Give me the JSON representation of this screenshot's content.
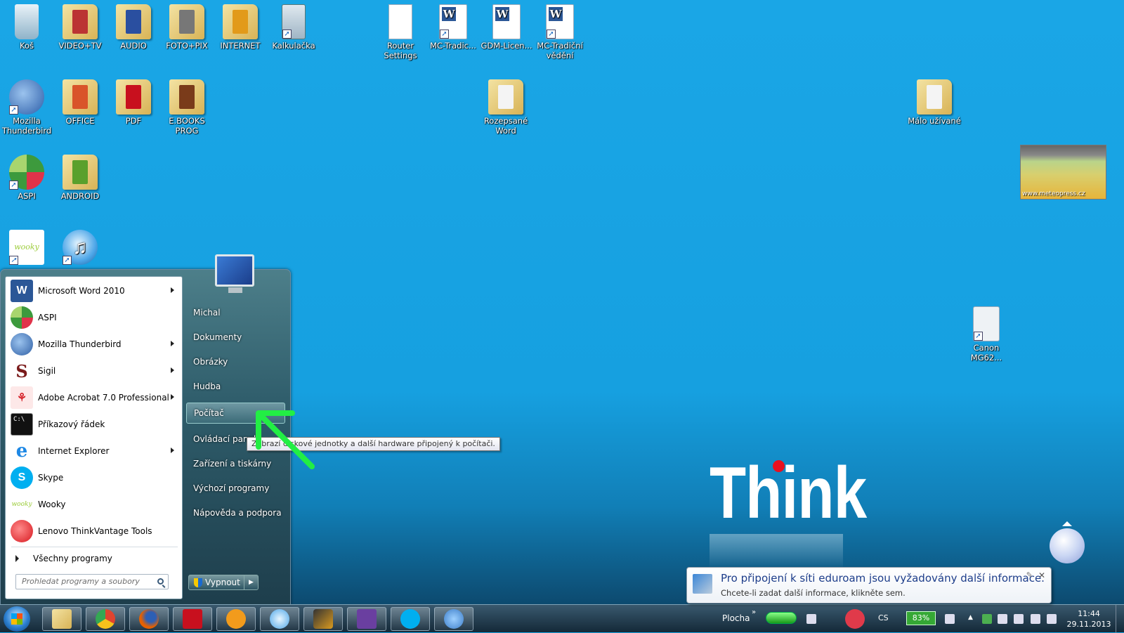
{
  "desktop": {
    "icons": [
      {
        "label": "Koš",
        "icon": "recycle-bin-icon"
      },
      {
        "label": "VIDEO+TV",
        "icon": "folder-icon"
      },
      {
        "label": "AUDIO",
        "icon": "folder-icon"
      },
      {
        "label": "FOTO+PIX",
        "icon": "folder-icon"
      },
      {
        "label": "INTERNET",
        "icon": "folder-icon"
      },
      {
        "label": "Kalkulačka",
        "icon": "calculator-icon"
      },
      {
        "label": "Router Settings",
        "icon": "document-icon"
      },
      {
        "label": "MC-Tradic...",
        "icon": "word-document-icon"
      },
      {
        "label": "GDM-Licen...",
        "icon": "word-document-icon"
      },
      {
        "label": "MC-Tradiční vědění",
        "icon": "word-document-icon"
      },
      {
        "label": "Mozilla Thunderbird",
        "icon": "thunderbird-icon"
      },
      {
        "label": "OFFICE",
        "icon": "folder-icon"
      },
      {
        "label": "PDF",
        "icon": "folder-icon"
      },
      {
        "label": "E.BOOKS PROG",
        "icon": "folder-icon"
      },
      {
        "label": "Rozepsané Word",
        "icon": "folder-icon"
      },
      {
        "label": "Málo užívané",
        "icon": "folder-icon"
      },
      {
        "label": "ASPI",
        "icon": "aspi-icon"
      },
      {
        "label": "ANDROID",
        "icon": "folder-icon"
      },
      {
        "label": "Canon MG62...",
        "icon": "printer-help-icon"
      },
      {
        "label": "",
        "icon": "wooky-icon"
      },
      {
        "label": "",
        "icon": "itunes-icon"
      }
    ],
    "brand_text": "Think",
    "weather_widget_text": "www.meteopress.cz"
  },
  "start_menu": {
    "programs": [
      {
        "label": "Microsoft Word 2010",
        "icon": "word-icon",
        "color": "#2b5797",
        "has_submenu": true
      },
      {
        "label": "ASPI",
        "icon": "aspi-icon",
        "color": "#3d9a3d",
        "has_submenu": false
      },
      {
        "label": "Mozilla Thunderbird",
        "icon": "thunderbird-icon",
        "color": "#2f5fa5",
        "has_submenu": true
      },
      {
        "label": "Sigil",
        "icon": "sigil-icon",
        "color": "#7a1a1a",
        "has_submenu": true
      },
      {
        "label": "Adobe Acrobat 7.0 Professional",
        "icon": "acrobat-icon",
        "color": "#d7282f",
        "has_submenu": true
      },
      {
        "label": "Příkazový řádek",
        "icon": "command-prompt-icon",
        "color": "#111111",
        "has_submenu": false
      },
      {
        "label": "Internet Explorer",
        "icon": "internet-explorer-icon",
        "color": "#1e88e5",
        "has_submenu": true
      },
      {
        "label": "Skype",
        "icon": "skype-icon",
        "color": "#00aff0",
        "has_submenu": false
      },
      {
        "label": "Wooky",
        "icon": "wooky-icon",
        "color": "#9ccc3a",
        "has_submenu": false
      },
      {
        "label": "Lenovo ThinkVantage Tools",
        "icon": "thinkvantage-icon",
        "color": "#d71920",
        "has_submenu": false
      }
    ],
    "all_programs": "Všechny programy",
    "search_placeholder": "Prohledat programy a soubory",
    "right_items": [
      {
        "label": "Michal"
      },
      {
        "label": "Dokumenty"
      },
      {
        "label": "Obrázky"
      },
      {
        "label": "Hudba"
      },
      {
        "label": "Počítač",
        "highlighted": true
      },
      {
        "label": "Ovládací panely"
      },
      {
        "label": "Zařízení a tiskárny"
      },
      {
        "label": "Výchozí programy"
      },
      {
        "label": "Nápověda a podpora"
      }
    ],
    "shutdown_label": "Vypnout",
    "tooltip": "Zobrazí diskové jednotky a další hardware připojený k počítači."
  },
  "taskbar": {
    "pinned": [
      {
        "name": "explorer",
        "icon": "folder-icon",
        "color": "#e5c55a"
      },
      {
        "name": "chrome",
        "icon": "chrome-icon",
        "color": "#e0442f"
      },
      {
        "name": "firefox",
        "icon": "firefox-icon",
        "color": "#e66000"
      },
      {
        "name": "acrobat",
        "icon": "acrobat-icon",
        "color": "#c8101e"
      },
      {
        "name": "app",
        "icon": "ubuntu-like-icon",
        "color": "#f29b1c"
      },
      {
        "name": "itunes",
        "icon": "itunes-icon",
        "color": "#4da6e8"
      },
      {
        "name": "winamp",
        "icon": "winamp-icon",
        "color": "#d99a1f"
      },
      {
        "name": "visual-studio",
        "icon": "visual-studio-icon",
        "color": "#6a3fa0"
      },
      {
        "name": "skype",
        "icon": "skype-icon",
        "color": "#00aff0"
      },
      {
        "name": "ie-globe",
        "icon": "globe-icon",
        "color": "#3d7ec9"
      }
    ],
    "toolbar_label": "Plocha",
    "language": "CS",
    "battery": "83%",
    "time": "11:44",
    "date": "29.11.2013"
  },
  "notification": {
    "title": "Pro připojení k síti eduroam jsou vyžadovány další informace.",
    "text": "Chcete-li zadat další informace, klikněte sem."
  }
}
